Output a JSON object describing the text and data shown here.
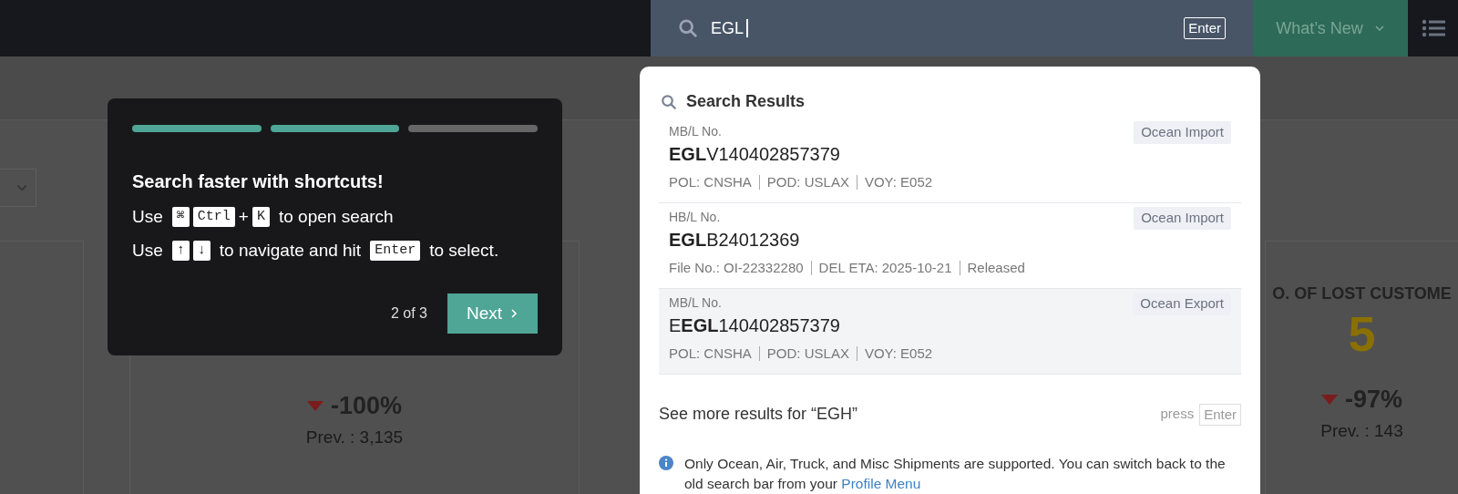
{
  "top_bar": {
    "search": {
      "value": "EGL",
      "focused": true,
      "key": "Enter"
    },
    "whats_new": "What’s New"
  },
  "dashboard": {
    "cards": [
      {
        "kind": "blank"
      },
      {
        "kind": "stat",
        "delta": "-100%",
        "prev": "Prev. : 3,135"
      },
      {
        "kind": "stat_titled",
        "title": "O. OF LOST CUSTOME",
        "value": "5",
        "delta": "-97%",
        "prev": "Prev. : 143"
      }
    ]
  },
  "tour": {
    "steps": [
      {
        "done": true
      },
      {
        "done": true
      },
      {
        "done": false
      }
    ],
    "title": "Search faster with shortcuts!",
    "lines": [
      [
        {
          "kind": "text",
          "text": "Use"
        },
        {
          "kind": "key",
          "text": "⌘"
        },
        {
          "kind": "key",
          "text": "Ctrl"
        },
        {
          "kind": "plus",
          "text": "+"
        },
        {
          "kind": "key",
          "text": "K"
        },
        {
          "kind": "text",
          "text": "to open search"
        }
      ],
      [
        {
          "kind": "text",
          "text": "Use"
        },
        {
          "kind": "key",
          "text": "↑"
        },
        {
          "kind": "key",
          "text": "↓"
        },
        {
          "kind": "text",
          "text": "to navigate and hit"
        },
        {
          "kind": "key",
          "text": "Enter"
        },
        {
          "kind": "text",
          "text": "to select."
        }
      ]
    ],
    "counter": "2 of 3",
    "next": "Next"
  },
  "search_results": {
    "title": "Search Results",
    "results": [
      {
        "label": "MB/L No.",
        "number": "**EGL**V140402857379",
        "type": "Ocean Import",
        "details": [
          "POL: CNSHA",
          "POD: USLAX",
          "VOY: E052"
        ],
        "selected": false
      },
      {
        "label": "HB/L No.",
        "number": "**EGL**B24012369",
        "type": "Ocean Import",
        "details": [
          "File No.: OI-22332280",
          "DEL ETA: 2025-10-21",
          "Released"
        ],
        "selected": false
      },
      {
        "label": "MB/L No.",
        "number": "E**EGL**140402857379",
        "type": "Ocean Export",
        "details": [
          "POL: CNSHA",
          "POD: USLAX",
          "VOY: E052"
        ],
        "selected": true
      }
    ],
    "see_more": "See more results for “EGH”",
    "press": "press",
    "press_key": "Enter",
    "note": "Only Ocean, Air, Truck, and Misc Shipments are supported. You can switch back to the old search bar from your",
    "note_link": "Profile Menu"
  }
}
